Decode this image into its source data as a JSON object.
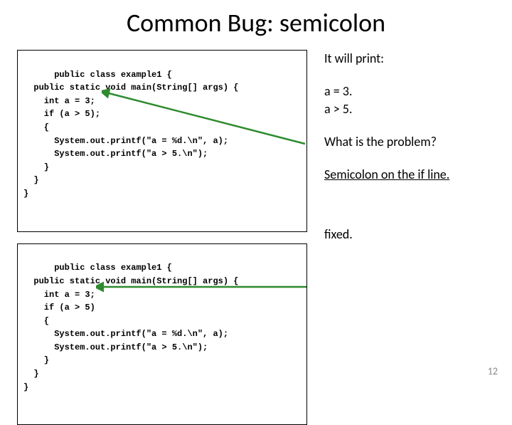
{
  "title": "Common Bug: semicolon",
  "code1": "public class example1 {\n  public static void main(String[] args) {\n    int a = 3;\n    if (a > 5);\n    {\n      System.out.printf(\"a = %d.\\n\", a);\n      System.out.printf(\"a > 5.\\n\");\n    }\n  }\n}",
  "code2": "public class example1 {\n  public static void main(String[] args) {\n    int a = 3;\n    if (a > 5)\n    {\n      System.out.printf(\"a = %d.\\n\", a);\n      System.out.printf(\"a > 5.\\n\");\n    }\n  }\n}",
  "right": {
    "r1": "It will print:",
    "r2a": "a = 3.",
    "r2b": "a > 5.",
    "r3": "What is the problem?",
    "r4": "Semicolon on the if line.",
    "r5": "fixed."
  },
  "page_number": "12"
}
